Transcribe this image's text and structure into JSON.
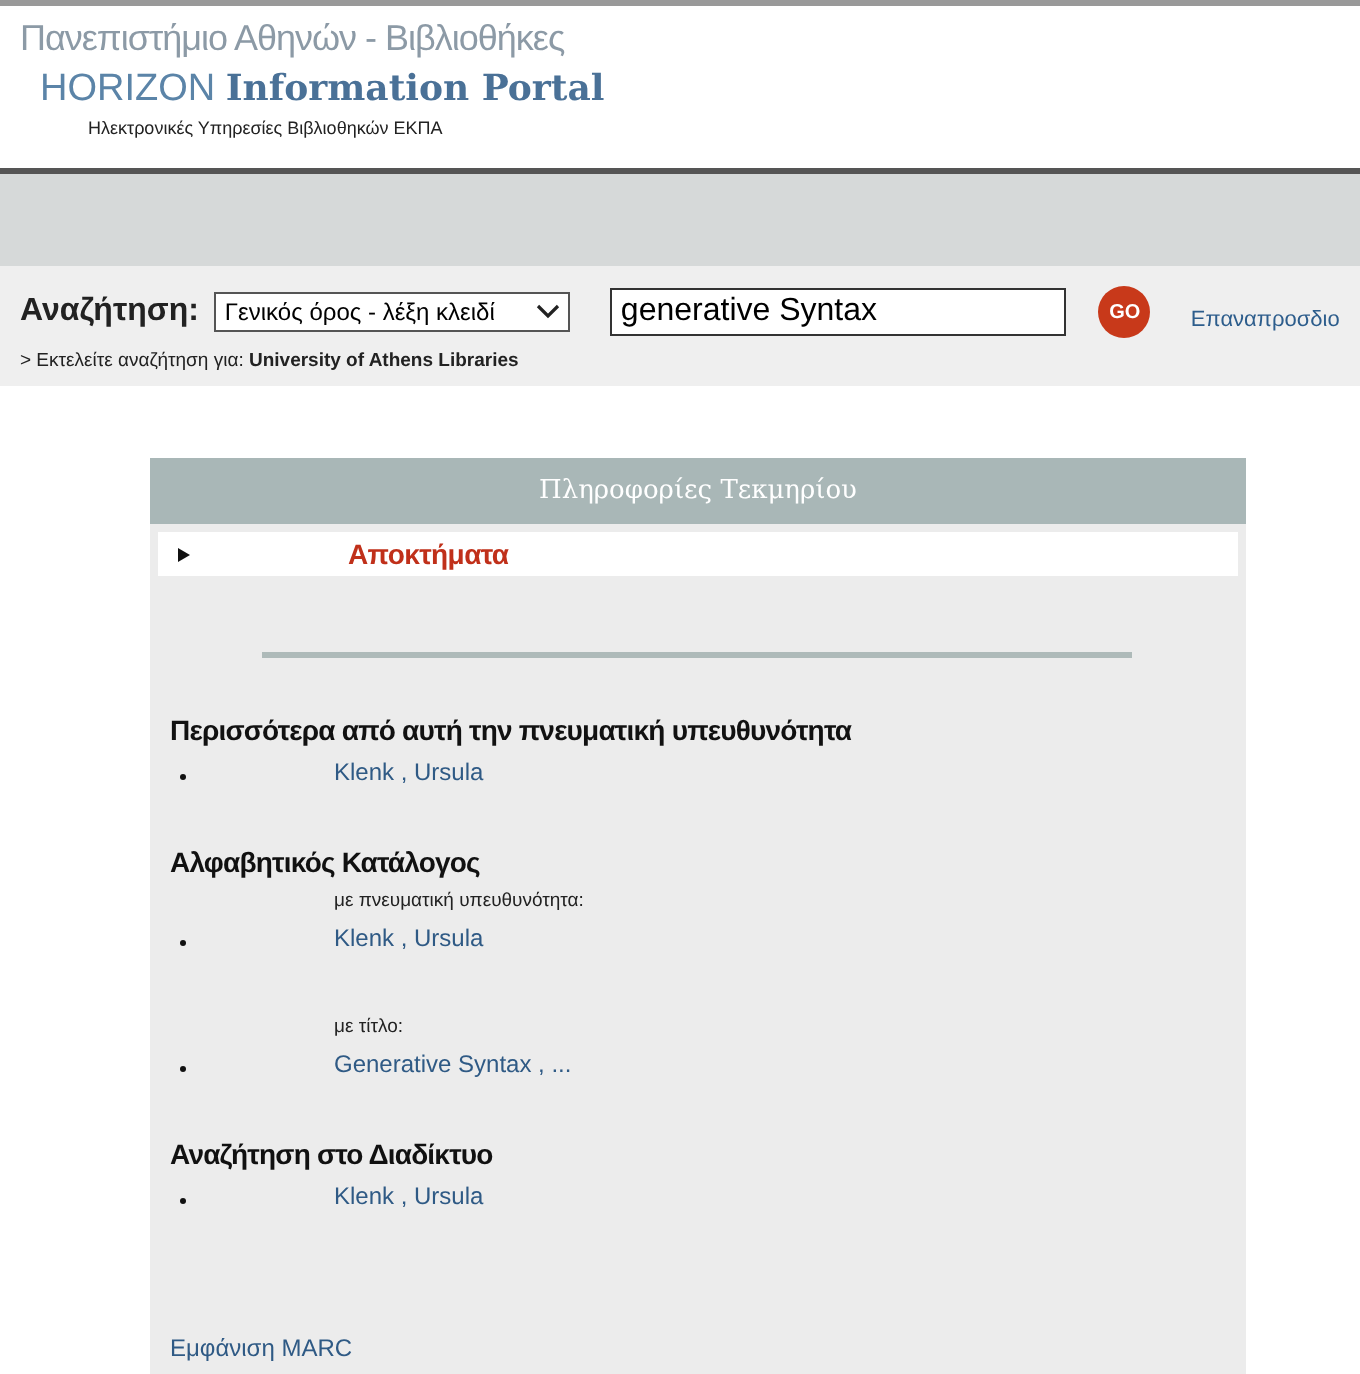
{
  "header": {
    "university": "Πανεπιστήμιο Αθηνών - Βιβλιοθήκες",
    "product_prefix": "HORIZON",
    "product": "Information Portal",
    "subtitle": "Ηλεκτρονικές Υπηρεσίες Βιβλιοθηκών ΕΚΠΑ"
  },
  "search": {
    "label": "Αναζήτηση:",
    "select_value": "Γενικός όρος - λέξη κλειδί",
    "query": "generative Syntax",
    "go": "GO",
    "link": "Επαναπροσδιο",
    "scope_label": "> Εκτελείτε αναζήτηση για:",
    "scope": "University of Athens Libraries"
  },
  "panel": {
    "title": "Πληροφορίες Τεκμηρίου",
    "tabs": [
      {
        "label": "Αποκτήματα",
        "selected": true
      }
    ],
    "sections": [
      {
        "heading": "Περισσότερα από αυτή την πνευματική υπευθυνότητα",
        "groups": [
          {
            "links": [
              "Klenk , Ursula"
            ]
          }
        ]
      },
      {
        "heading": "Αλφαβητικός Κατάλογος",
        "groups": [
          {
            "label": "με πνευματική υπευθυνότητα:",
            "links": [
              "Klenk , Ursula"
            ]
          },
          {
            "label": "με τίτλο:",
            "links": [
              "Generative Syntax , ..."
            ]
          }
        ]
      },
      {
        "heading": "Αναζήτηση στο Διαδίκτυο",
        "groups": [
          {
            "links": [
              "Klenk , Ursula"
            ]
          }
        ]
      }
    ],
    "footer_link": "Εμφάνιση MARC"
  }
}
